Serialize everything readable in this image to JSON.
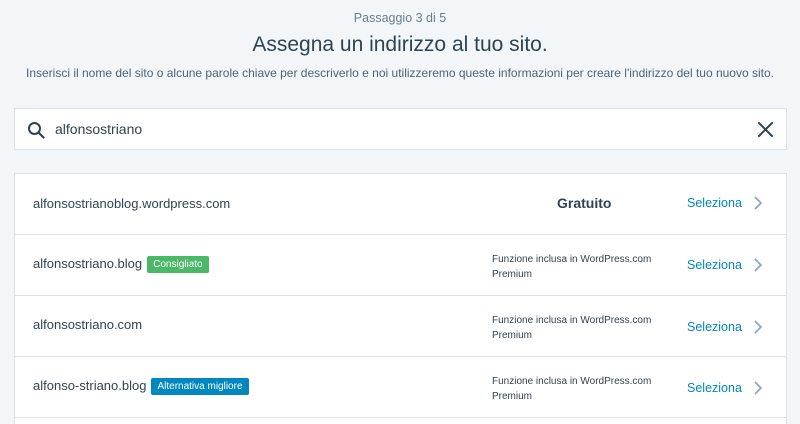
{
  "header": {
    "step": "Passaggio 3 di 5",
    "title": "Assegna un indirizzo al tuo sito.",
    "subtitle": "Inserisci il nome del sito o alcune parole chiave per descriverlo e noi utilizzeremo queste informazioni per creare l'indirizzo del tuo nuovo sito."
  },
  "search": {
    "value": "alfonsostriano",
    "icon": "search-icon",
    "clear_icon": "close-icon"
  },
  "results": [
    {
      "domain": "alfonsostrianoblog.wordpress.com",
      "badge": "",
      "price": "Gratuito",
      "select": "Seleziona"
    },
    {
      "domain": "alfonsostriano.blog",
      "badge": "Consigliato",
      "price_line1": "Funzione inclusa in WordPress.com",
      "price_line2": "Premium",
      "select": "Seleziona"
    },
    {
      "domain": "alfonsostriano.com",
      "badge": "",
      "price_line1": "Funzione inclusa in WordPress.com",
      "price_line2": "Premium",
      "select": "Seleziona"
    },
    {
      "domain": "alfonso-striano.blog",
      "badge": "Alternativa migliore",
      "price_line1": "Funzione inclusa in WordPress.com",
      "price_line2": "Premium",
      "select": "Seleziona"
    }
  ],
  "colors": {
    "accent": "#0087be",
    "badge_recommended": "#4ab866",
    "badge_best": "#0087be"
  }
}
